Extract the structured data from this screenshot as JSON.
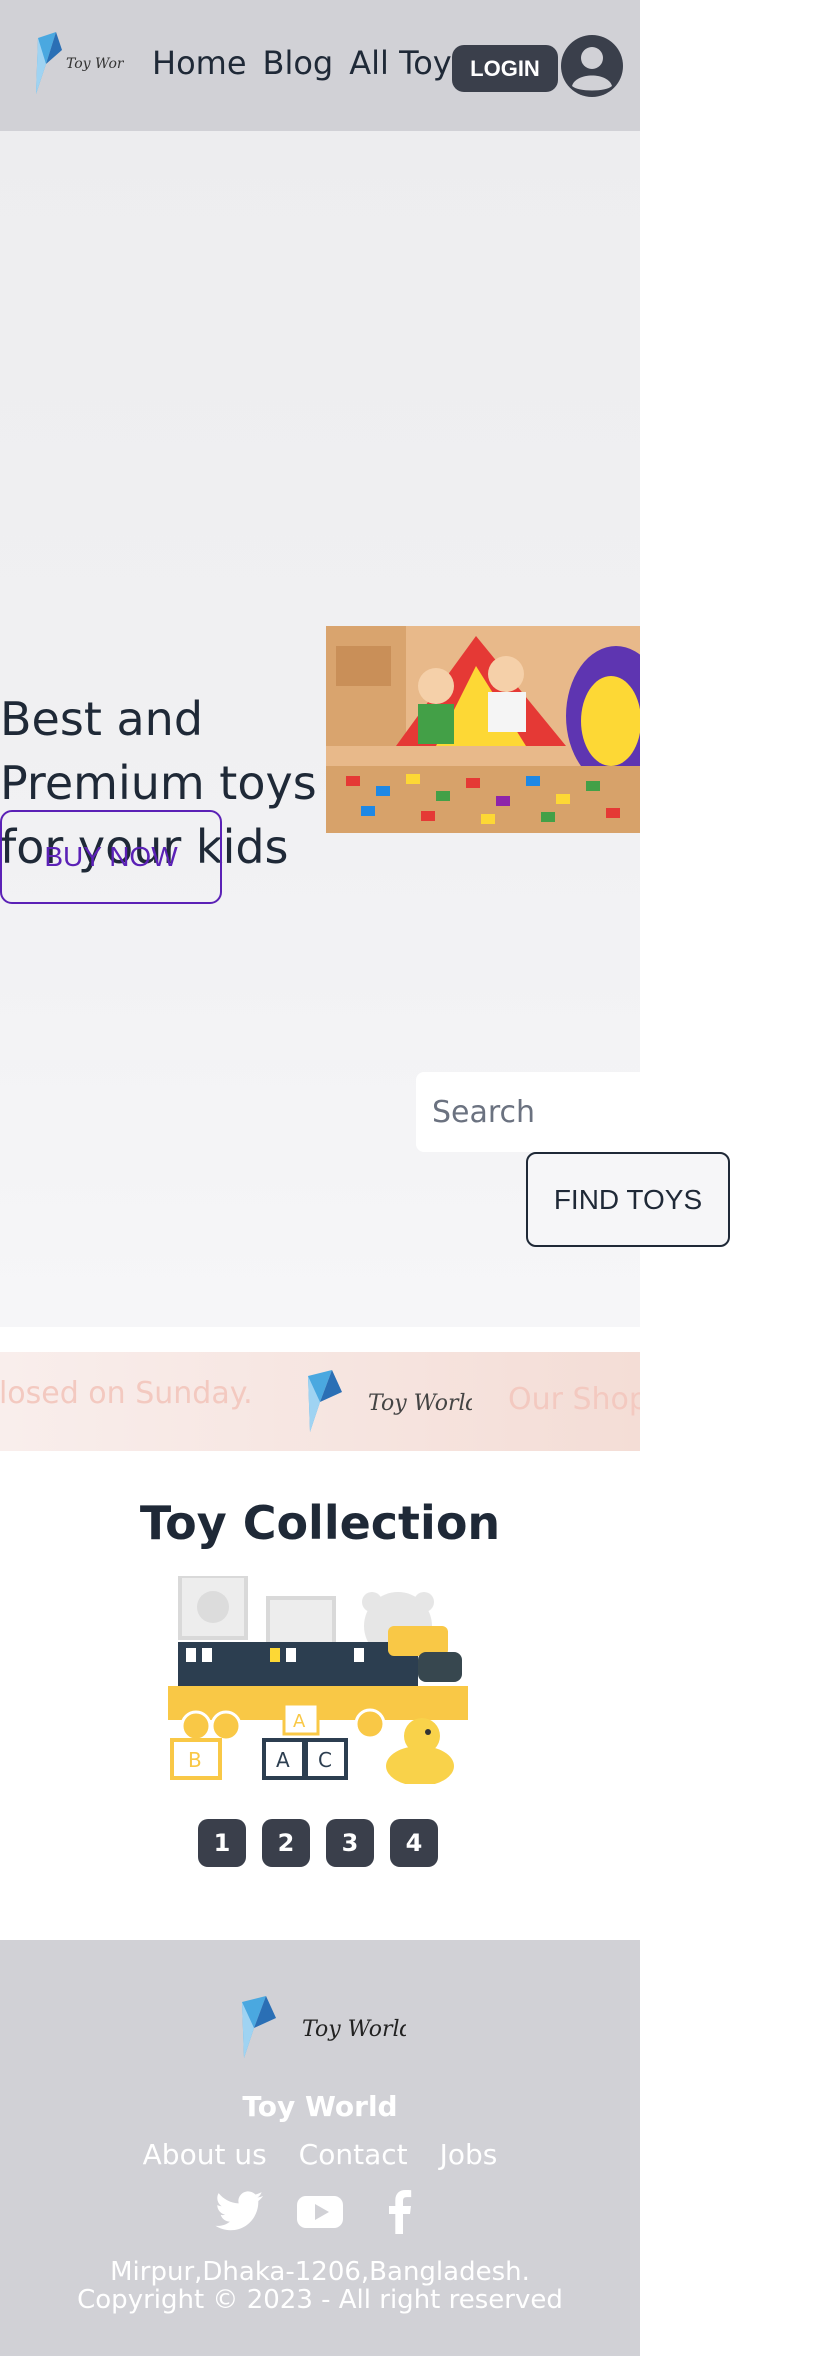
{
  "brand": {
    "logo_text": "Toy World"
  },
  "nav": {
    "links": [
      "Home",
      "Blog",
      "All Toys"
    ],
    "login_label": "LOGIN"
  },
  "hero": {
    "title": "Best and Premium toys for your kids",
    "buy_label": "BUY NOW",
    "search_placeholder": "Search",
    "find_label": "FIND TOYS"
  },
  "band": {
    "text_left": "Closed on Sunday.",
    "text_right": "Our Shop"
  },
  "collection": {
    "title": "Toy Collection",
    "pages": [
      "1",
      "2",
      "3",
      "4"
    ]
  },
  "footer": {
    "name": "Toy World",
    "links": [
      "About us",
      "Contact",
      "Jobs"
    ],
    "address": "Mirpur,Dhaka-1206,Bangladesh.",
    "copyright": "Copyright © 2023 - All right reserved"
  },
  "colors": {
    "accent": "#5b21b6",
    "dark_button": "#3a3f4b",
    "nav_bg": "#d1d1d6"
  }
}
